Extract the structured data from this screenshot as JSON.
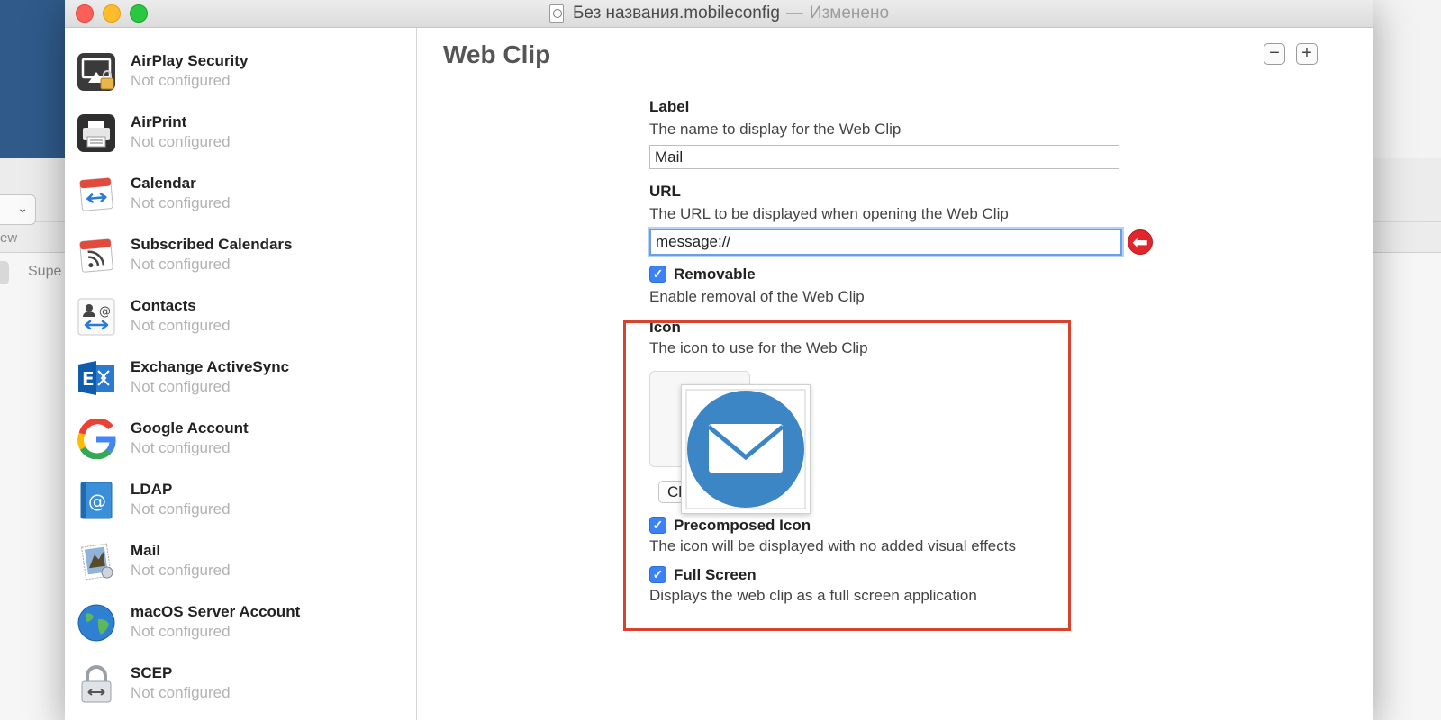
{
  "window": {
    "title": "Без названия.mobileconfig",
    "separator": "—",
    "status": "Изменено"
  },
  "background_app": {
    "view_label": "ew",
    "tab_label": "Supe"
  },
  "sidebar": {
    "items": [
      {
        "name": "AirPlay Security",
        "status": "Not configured",
        "icon": "airplay-security-icon"
      },
      {
        "name": "AirPrint",
        "status": "Not configured",
        "icon": "printer-icon"
      },
      {
        "name": "Calendar",
        "status": "Not configured",
        "icon": "calendar-icon"
      },
      {
        "name": "Subscribed Calendars",
        "status": "Not configured",
        "icon": "subscribed-calendar-icon"
      },
      {
        "name": "Contacts",
        "status": "Not configured",
        "icon": "contacts-icon"
      },
      {
        "name": "Exchange ActiveSync",
        "status": "Not configured",
        "icon": "exchange-icon"
      },
      {
        "name": "Google Account",
        "status": "Not configured",
        "icon": "google-icon"
      },
      {
        "name": "LDAP",
        "status": "Not configured",
        "icon": "ldap-icon"
      },
      {
        "name": "Mail",
        "status": "Not configured",
        "icon": "mail-stamp-icon"
      },
      {
        "name": "macOS Server Account",
        "status": "Not configured",
        "icon": "globe-icon"
      },
      {
        "name": "SCEP",
        "status": "Not configured",
        "icon": "lock-icon"
      }
    ]
  },
  "content": {
    "title": "Web Clip",
    "remove_button": "−",
    "add_button": "+",
    "label": {
      "title": "Label",
      "description": "The name to display for the Web Clip",
      "value": "Mail"
    },
    "url": {
      "title": "URL",
      "description": "The URL to be displayed when opening the Web Clip",
      "value": "message://"
    },
    "removable": {
      "title": "Removable",
      "description": "Enable removal of the Web Clip",
      "checked": true
    },
    "icon": {
      "title": "Icon",
      "description": "The icon to use for the Web Clip",
      "choose_button": "Choose..."
    },
    "precomposed": {
      "title": "Precomposed Icon",
      "description": "The icon will be displayed with no added visual effects",
      "checked": true
    },
    "full_screen": {
      "title": "Full Screen",
      "description": "Displays the web clip as a full screen application",
      "checked": true
    },
    "check_mark": "✓",
    "remove_glyph": "⬅"
  },
  "colors": {
    "highlight": "#d8432e",
    "checkbox": "#3b82f6",
    "mail_icon": "#3d86c6"
  }
}
